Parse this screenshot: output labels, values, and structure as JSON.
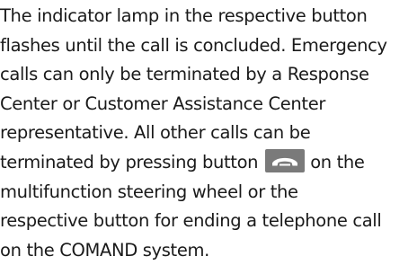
{
  "paragraph": {
    "line1": "The indicator lamp in the respective button",
    "line2": "flashes until the call is concluded. Emergency",
    "line3": "calls can only be terminated by a Response",
    "line4": "Center or Customer Assistance Center",
    "line5": "representative. All other calls can be",
    "line6_before_icon": "terminated by pressing button",
    "line6_after_icon": "on the",
    "line7": "multifunction steering wheel or the",
    "line8": "respective button for ending a telephone call",
    "line9": "on the COMAND system."
  },
  "icons": {
    "end_call_button": "end-call-phone-icon",
    "button_color": "#7a7a7a",
    "glyph_color": "#ffffff"
  },
  "colors": {
    "text": "#1a1a1a",
    "background": "#ffffff"
  }
}
